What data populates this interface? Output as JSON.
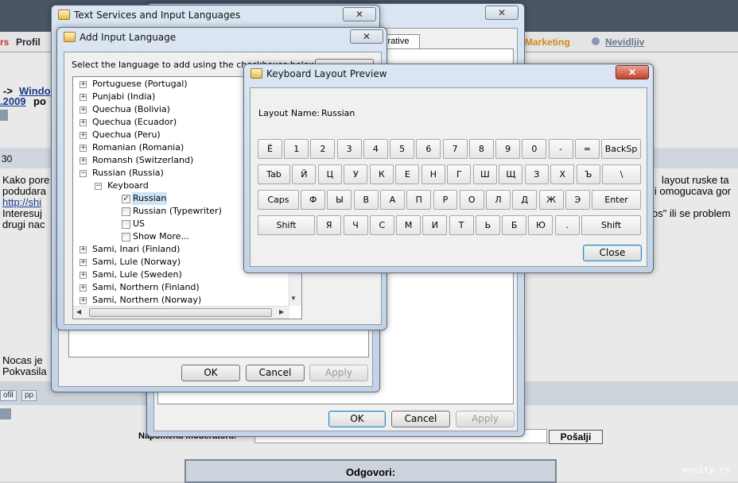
{
  "background": {
    "nav_left": "rs",
    "nav_profil": "Profil",
    "nav_marketing": "Marketing",
    "nav_nevidljiv": "Nevidljiv",
    "crumb_prefix": "->",
    "crumb_link": "Windo",
    "date_fragment": ".2009",
    "date_suffix": "po",
    "post_number": "30",
    "post_line1": "Kako pore",
    "post_line2": "podudara",
    "post_link": "http://shi",
    "post_line3": "Interesuj",
    "post_line4": "drugi nac",
    "right_line1": "layout ruske ta",
    "right_line2": "ji omogucava gor",
    "right_line3": "os\" ili se problem",
    "bottom_line1": "Nocas je",
    "bottom_line2": "Pokvasila",
    "btn_profil": "ofil",
    "btn_pp": "pp",
    "moderator_label": "Napomena moderatora:",
    "send_button": "Pošalji",
    "reply_title": "Odgovori:",
    "watermark": "mycity.rs"
  },
  "settings_tab_fragment": "rative",
  "text_services": {
    "title": "Text Services and Input Languages",
    "ok": "OK",
    "cancel": "Cancel",
    "apply": "Apply"
  },
  "add_language": {
    "title": "Add Input Language",
    "instruction": "Select the language to add using the checkboxes below.",
    "tree": [
      {
        "label": "Portuguese (Portugal)",
        "kind": "lang"
      },
      {
        "label": "Punjabi (India)",
        "kind": "lang"
      },
      {
        "label": "Quechua (Bolivia)",
        "kind": "lang"
      },
      {
        "label": "Quechua (Ecuador)",
        "kind": "lang"
      },
      {
        "label": "Quechua (Peru)",
        "kind": "lang"
      },
      {
        "label": "Romanian (Romania)",
        "kind": "lang"
      },
      {
        "label": "Romansh (Switzerland)",
        "kind": "lang"
      },
      {
        "label": "Russian (Russia)",
        "kind": "lang-open"
      },
      {
        "label": "Keyboard",
        "kind": "group"
      },
      {
        "label": "Russian",
        "kind": "check",
        "checked": true
      },
      {
        "label": "Russian (Typewriter)",
        "kind": "check",
        "checked": false
      },
      {
        "label": "US",
        "kind": "check",
        "checked": false
      },
      {
        "label": "Show More...",
        "kind": "check",
        "checked": false
      },
      {
        "label": "Sami, Inari (Finland)",
        "kind": "lang"
      },
      {
        "label": "Sami, Lule (Norway)",
        "kind": "lang"
      },
      {
        "label": "Sami, Lule (Sweden)",
        "kind": "lang"
      },
      {
        "label": "Sami, Northern (Finland)",
        "kind": "lang"
      },
      {
        "label": "Sami, Northern (Norway)",
        "kind": "lang"
      }
    ],
    "ok": "OK",
    "cancel": "Cancel",
    "apply": "Apply"
  },
  "preview": {
    "title": "Keyboard Layout Preview",
    "layout_label": "Layout Name:",
    "layout_value": "Russian",
    "close": "Close",
    "rows": [
      [
        "Ё",
        "1",
        "2",
        "3",
        "4",
        "5",
        "6",
        "7",
        "8",
        "9",
        "0",
        "-",
        "=",
        "BackSp"
      ],
      [
        "Tab",
        "Й",
        "Ц",
        "У",
        "К",
        "Е",
        "Н",
        "Г",
        "Ш",
        "Щ",
        "З",
        "Х",
        "Ъ",
        "\\"
      ],
      [
        "Caps",
        "Ф",
        "Ы",
        "В",
        "А",
        "П",
        "Р",
        "О",
        "Л",
        "Д",
        "Ж",
        "Э",
        "Enter"
      ],
      [
        "Shift",
        "Я",
        "Ч",
        "С",
        "М",
        "И",
        "Т",
        "Ь",
        "Б",
        "Ю",
        ".",
        "Shift"
      ]
    ]
  }
}
